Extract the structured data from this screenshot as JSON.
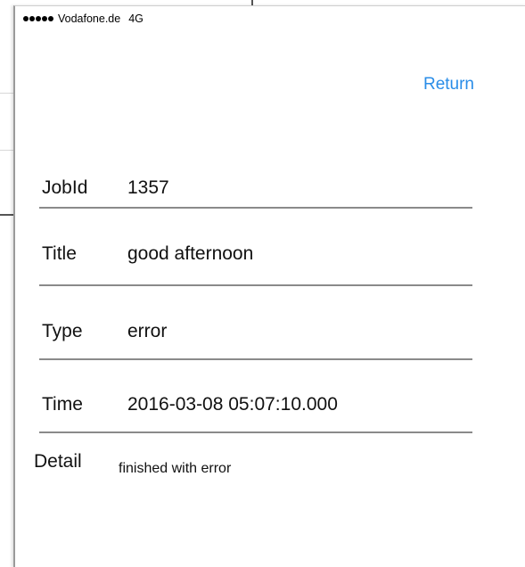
{
  "status_bar": {
    "signal_bars": 5,
    "carrier": "Vodafone.de",
    "network": "4G"
  },
  "nav": {
    "return_label": "Return"
  },
  "fields": [
    {
      "label": "JobId",
      "value": "1357"
    },
    {
      "label": "Title",
      "value": "good afternoon"
    },
    {
      "label": "Type",
      "value": "error"
    },
    {
      "label": "Time",
      "value": "2016-03-08 05:07:10.000"
    }
  ],
  "detail": {
    "label": "Detail",
    "value": "finished with error"
  },
  "colors": {
    "accent": "#2a8de8",
    "text": "#111111",
    "divider": "#8a8a8a"
  }
}
